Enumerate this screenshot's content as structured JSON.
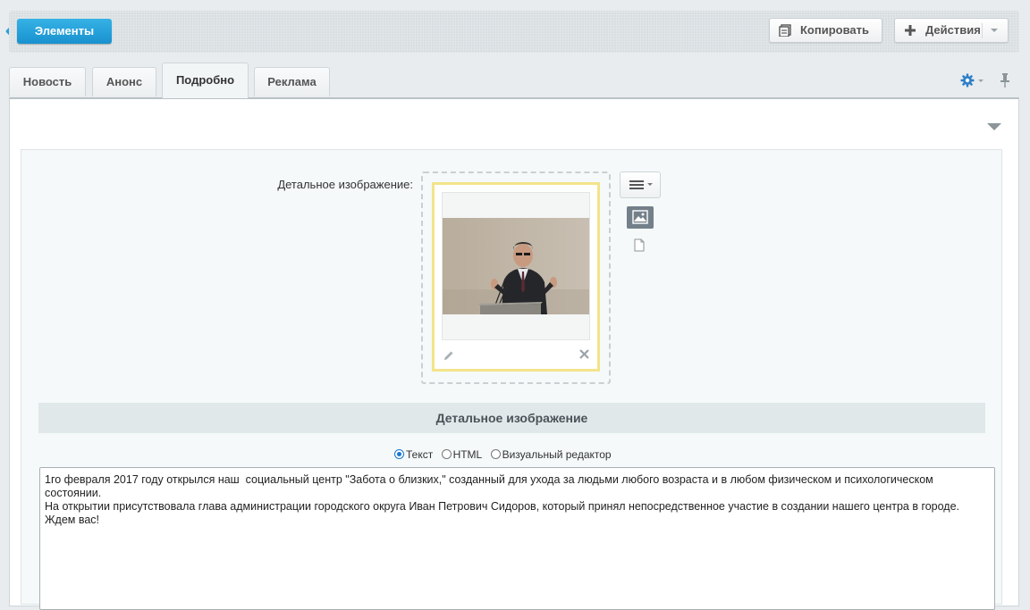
{
  "toolbar": {
    "back_label": "Элементы",
    "copy_label": "Копировать",
    "actions_label": "Действия"
  },
  "tabs": [
    {
      "label": "Новость",
      "active": false
    },
    {
      "label": "Анонс",
      "active": false
    },
    {
      "label": "Подробно",
      "active": true
    },
    {
      "label": "Реклама",
      "active": false
    }
  ],
  "form": {
    "detail_image_label": "Детальное изображение:",
    "section_title": "Детальное изображение",
    "editor_modes": [
      "Текст",
      "HTML",
      "Визуальный редактор"
    ],
    "selected_mode": "Текст",
    "detail_text": "1го февраля 2017 году открылся наш  социальный центр \"Забота о близких,\" созданный для ухода за людьми любого возраста и в любом физическом и психологическом состоянии.\nНа открытии присутствовала глава администрации городского округа Иван Петрович Сидоров, который принял непосредственное участие в создании нашего центра в городе.\nЖдем вас!"
  },
  "icons": {
    "copy": "copy-icon",
    "actions": "plus-icon",
    "settings": "gear-icon",
    "pin": "pin-icon",
    "edit": "pencil-icon",
    "delete": "close-icon",
    "menu": "hamburger-icon",
    "image_mode": "image-icon",
    "file_mode": "file-icon"
  },
  "colors": {
    "accent": "#1891cf",
    "image_highlight": "#f3e48a",
    "radio_selected": "#1976d2"
  }
}
